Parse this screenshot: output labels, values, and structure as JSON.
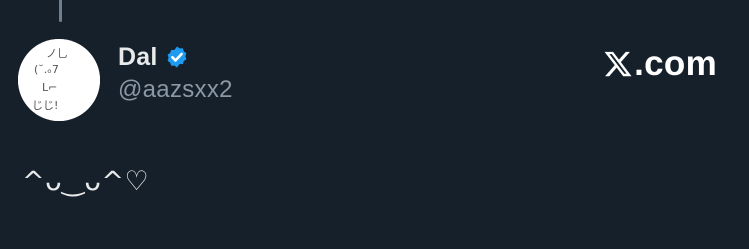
{
  "author": {
    "display_name": "Dal",
    "handle": "@aazsxx2",
    "verified": true,
    "avatar_art": [
      "ノ乚",
      "(˘.ₒ7",
      "L⌐",
      "じじ!"
    ]
  },
  "site": {
    "logo_icon": "x-logo-icon",
    "domain": ".com"
  },
  "tweet": {
    "text": "^ᴗ‿ᴗ^♡"
  },
  "colors": {
    "background": "#15202b",
    "verified_badge": "#1d9bf0",
    "handle_text": "#8b98a5"
  }
}
